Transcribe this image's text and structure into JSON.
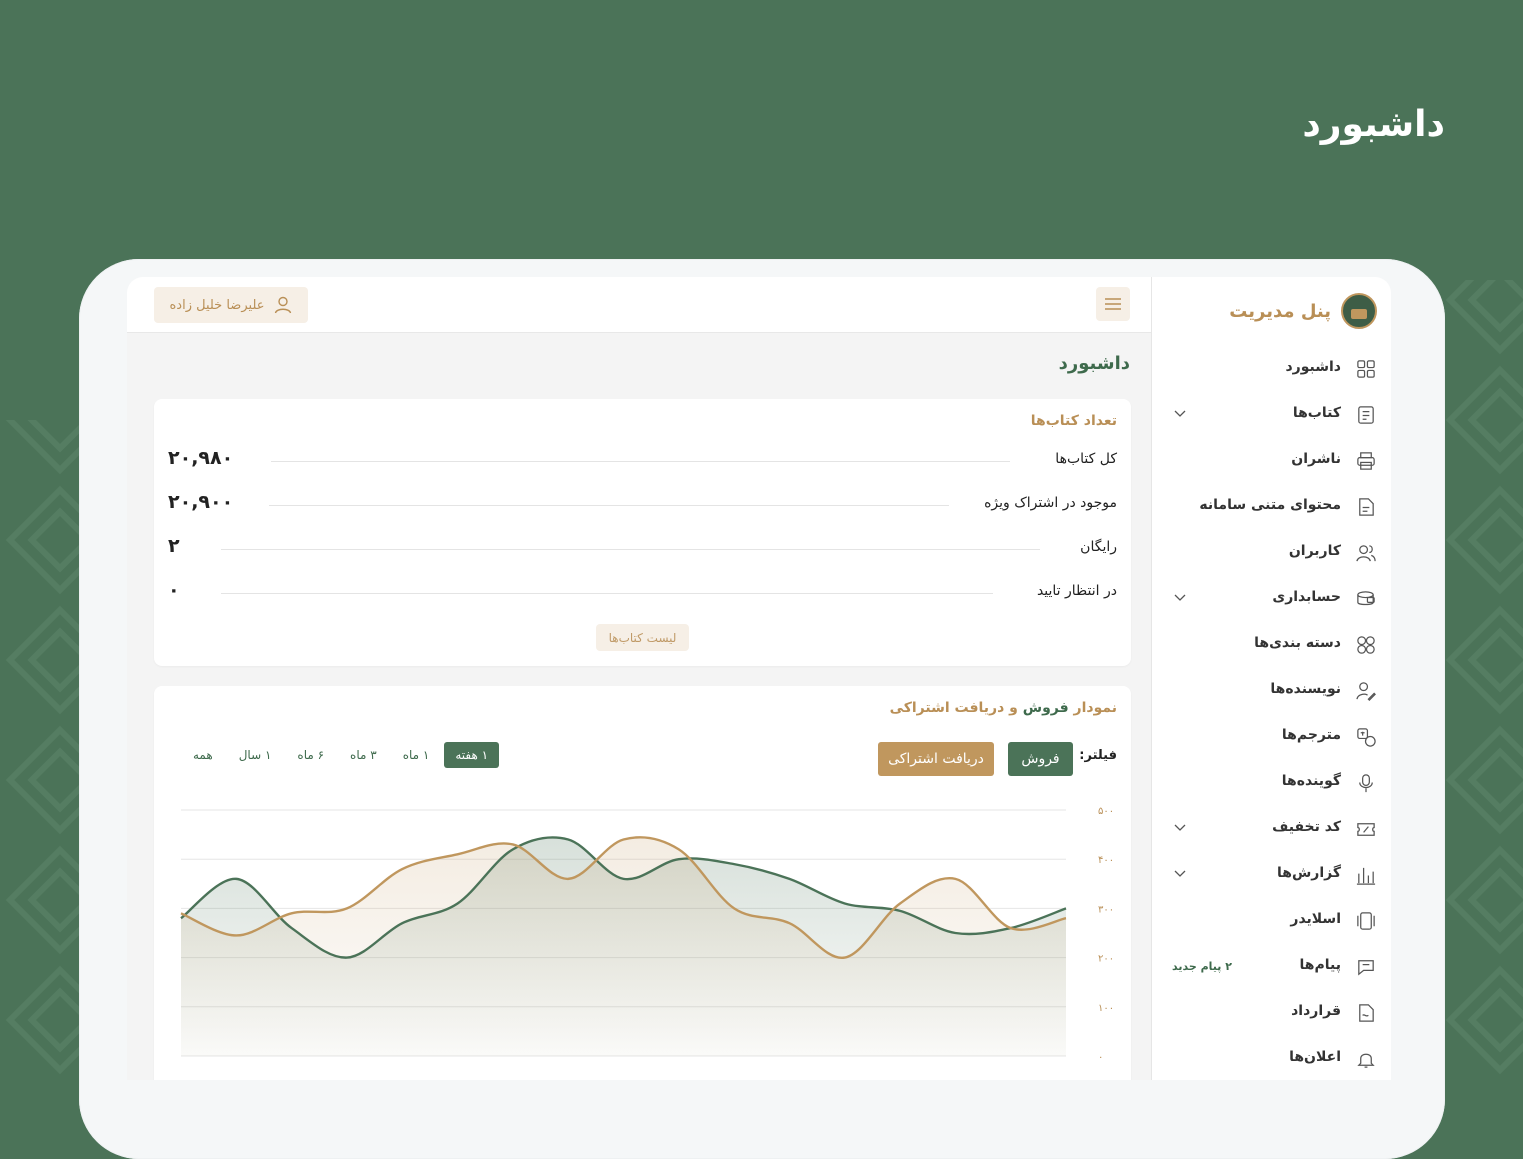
{
  "hero": {
    "title": "داشبورد"
  },
  "sidebar": {
    "brand": "پنل مدیریت",
    "items": [
      {
        "label": "داشبورد",
        "icon": "grid-icon",
        "chevron": false
      },
      {
        "label": "کتاب‌ها",
        "icon": "book-icon",
        "chevron": true
      },
      {
        "label": "ناشران",
        "icon": "printer-icon",
        "chevron": false
      },
      {
        "label": "محتوای متنی سامانه",
        "icon": "document-icon",
        "chevron": false
      },
      {
        "label": "کاربران",
        "icon": "users-icon",
        "chevron": false
      },
      {
        "label": "حسابداری",
        "icon": "wallet-icon",
        "chevron": true
      },
      {
        "label": "دسته بندی‌ها",
        "icon": "categories-icon",
        "chevron": false
      },
      {
        "label": "نویسنده‌ها",
        "icon": "writer-icon",
        "chevron": false
      },
      {
        "label": "مترجم‌ها",
        "icon": "translate-icon",
        "chevron": false
      },
      {
        "label": "گوینده‌ها",
        "icon": "microphone-icon",
        "chevron": false
      },
      {
        "label": "کد تخفیف",
        "icon": "ticket-icon",
        "chevron": true
      },
      {
        "label": "گزارش‌ها",
        "icon": "bar-chart-icon",
        "chevron": true
      },
      {
        "label": "اسلایدر",
        "icon": "slider-icon",
        "chevron": false
      },
      {
        "label": "پیام‌ها",
        "icon": "message-icon",
        "chevron": false,
        "badge": "۲ پیام جدید"
      },
      {
        "label": "قرارداد",
        "icon": "contract-icon",
        "chevron": false
      },
      {
        "label": "اعلان‌ها",
        "icon": "bell-icon",
        "chevron": false
      }
    ]
  },
  "topbar": {
    "user_name": "علیرضا خلیل زاده"
  },
  "page": {
    "title": "داشبورد"
  },
  "books_card": {
    "title": "تعداد کتاب‌ها",
    "stats": [
      {
        "label": "کل کتاب‌ها",
        "value": "۲۰,۹۸۰"
      },
      {
        "label": "موجود در اشتراک ویژه",
        "value": "۲۰,۹۰۰"
      },
      {
        "label": "رایگان",
        "value": "۲"
      },
      {
        "label": "در انتظار تایید",
        "value": "۰"
      }
    ],
    "list_button": "لیست کتاب‌ها"
  },
  "chart_card": {
    "title_prefix": "نمودار ",
    "title_highlight": "فروش",
    "title_suffix": " و دریافت اشتراکی",
    "filter_label": "فیلتر:",
    "btn_sale": "فروش",
    "btn_subscription": "دریافت اشتراکی",
    "ranges": [
      "۱ هفته",
      "۱ ماه",
      "۳ ماه",
      "۶ ماه",
      "۱ سال",
      "همه"
    ],
    "active_range": 0
  },
  "colors": {
    "green": "#4b7358",
    "gold": "#c0975e",
    "sale_line": "#4b7358",
    "subscription_line": "#c0975e"
  },
  "chart_data": {
    "type": "area",
    "ylim": [
      0,
      500
    ],
    "y_ticks": [
      "۰",
      "۱۰۰",
      "۲۰۰",
      "۳۰۰",
      "۴۰۰",
      "۵۰۰"
    ],
    "x": [
      0,
      1,
      2,
      3,
      4,
      5,
      6,
      7,
      8,
      9,
      10,
      11,
      12,
      13,
      14,
      15,
      16
    ],
    "series": [
      {
        "color": "#4b7358",
        "values": [
          280,
          360,
          260,
          200,
          270,
          310,
          420,
          440,
          360,
          400,
          390,
          360,
          310,
          295,
          250,
          260,
          300
        ]
      },
      {
        "color": "#c0975e",
        "values": [
          290,
          245,
          290,
          300,
          380,
          410,
          430,
          360,
          440,
          420,
          300,
          270,
          200,
          310,
          360,
          260,
          280
        ]
      }
    ]
  }
}
